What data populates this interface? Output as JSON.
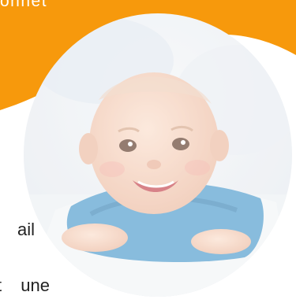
{
  "banner": {
    "title_fragment": "onnet",
    "background_color": "#F7990C"
  },
  "photo": {
    "subject": "smiling-baby-photo",
    "overlay_color": "#FFFFFF"
  },
  "article": {
    "line1_fragment": "ail",
    "line2_fragment": "t une"
  },
  "colors": {
    "accent": "#F7990C",
    "text": "#222222",
    "background": "#FFFFFF"
  }
}
